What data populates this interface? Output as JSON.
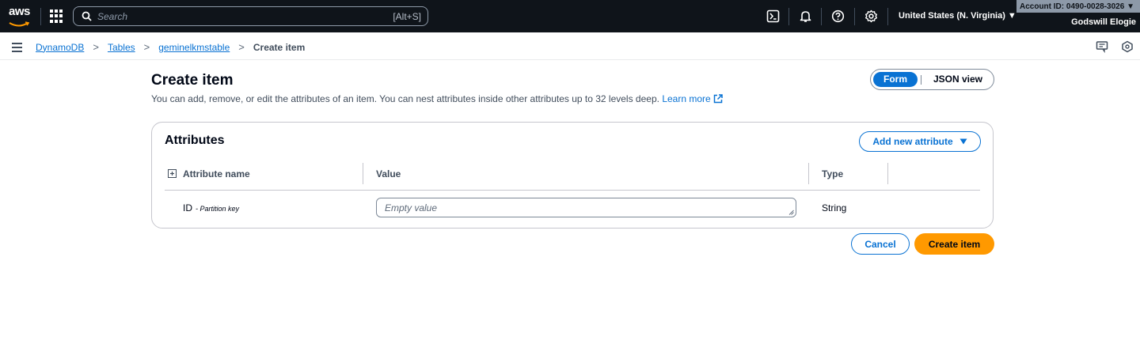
{
  "topnav": {
    "logo_text": "aws",
    "search_placeholder": "Search",
    "search_shortcut": "[Alt+S]",
    "region": "United States (N. Virginia) ▼",
    "account": "Account ID: 0490-0028-3026 ▼",
    "username": "Godswill Elogie",
    "icons": [
      "services-grid-icon",
      "cloudshell-icon",
      "notifications-bell-icon",
      "help-icon",
      "settings-gear-icon"
    ]
  },
  "breadcrumb": {
    "items": [
      "DynamoDB",
      "Tables",
      "geminelkmstable"
    ],
    "current": "Create item",
    "separator": ">"
  },
  "header": {
    "title": "Create item",
    "description": "You can add, remove, or edit the attributes of an item. You can nest attributes inside other attributes up to 32 levels deep.",
    "learn_more": "Learn more",
    "view_toggle": {
      "active": "Form",
      "inactive": "JSON view"
    }
  },
  "attributes_panel": {
    "title": "Attributes",
    "add_button": "Add new attribute",
    "columns": [
      "Attribute name",
      "Value",
      "Type"
    ],
    "rows": [
      {
        "name": "ID",
        "key_label": "- Partition key",
        "value_placeholder": "Empty value",
        "type": "String"
      }
    ]
  },
  "actions": {
    "cancel": "Cancel",
    "submit": "Create item"
  },
  "colors": {
    "nav_bg": "#0f141a",
    "link_blue": "#0972d3",
    "primary_orange": "#ff9900"
  }
}
